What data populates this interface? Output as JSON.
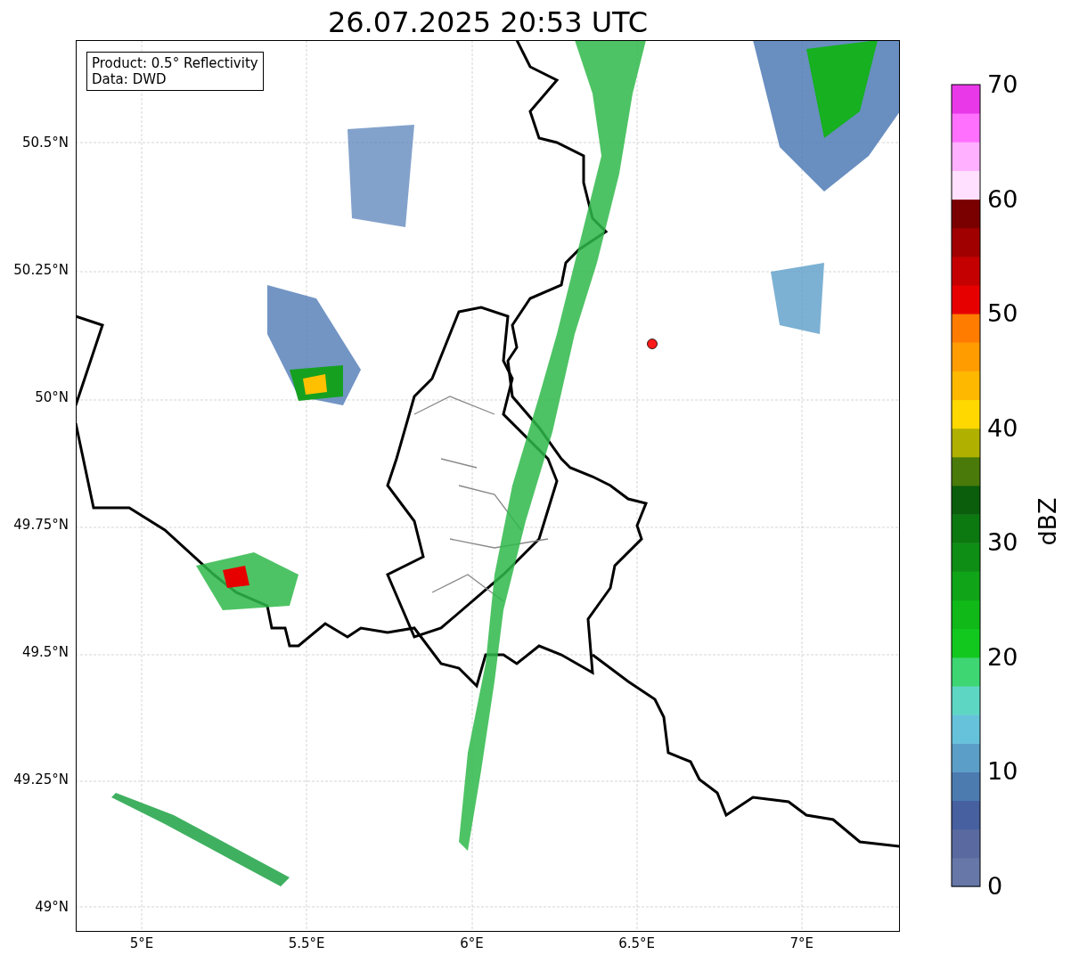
{
  "title": "26.07.2025 20:53 UTC",
  "info_box": {
    "lines": [
      "Product: 0.5° Reflectivity",
      "Data: DWD"
    ]
  },
  "map": {
    "y_ticks": [
      "50.5°N",
      "50.25°N",
      "50°N",
      "49.75°N",
      "49.5°N",
      "49.25°N",
      "49°N"
    ],
    "x_ticks": [
      "5°E",
      "5.5°E",
      "6°E",
      "6.5°E",
      "7°E"
    ]
  },
  "colorbar": {
    "label": "dBZ",
    "ticks": [
      "70",
      "60",
      "50",
      "40",
      "30",
      "20",
      "10",
      "0"
    ],
    "bands": [
      {
        "color": "#6677a8"
      },
      {
        "color": "#5a6aa0"
      },
      {
        "color": "#4660a0"
      },
      {
        "color": "#4c7bb0"
      },
      {
        "color": "#5b9ec8"
      },
      {
        "color": "#66c2da"
      },
      {
        "color": "#5ed6c4"
      },
      {
        "color": "#3ed672"
      },
      {
        "color": "#12c81e"
      },
      {
        "color": "#10b818"
      },
      {
        "color": "#10a418"
      },
      {
        "color": "#0e8e14"
      },
      {
        "color": "#0c7810"
      },
      {
        "color": "#0a5e0c"
      },
      {
        "color": "#4a7a0a"
      },
      {
        "color": "#b0b000"
      },
      {
        "color": "#ffd800"
      },
      {
        "color": "#ffb800"
      },
      {
        "color": "#ff9c00"
      },
      {
        "color": "#ff7c00"
      },
      {
        "color": "#e60000"
      },
      {
        "color": "#c40000"
      },
      {
        "color": "#a00000"
      },
      {
        "color": "#7a0000"
      },
      {
        "color": "#ffe0ff"
      },
      {
        "color": "#ffb0ff"
      },
      {
        "color": "#ff70ff"
      },
      {
        "color": "#e838e8"
      }
    ]
  }
}
